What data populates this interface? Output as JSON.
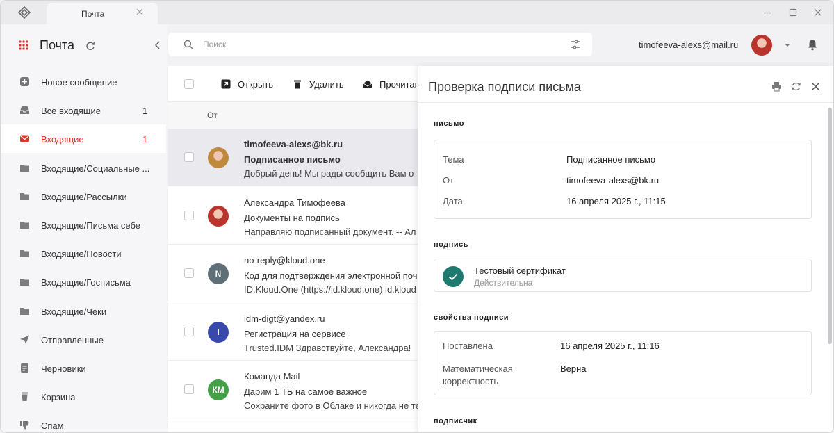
{
  "tab": {
    "title": "Почта"
  },
  "header": {
    "app_title": "Почта",
    "search_placeholder": "Поиск",
    "account_email": "timofeeva-alexs@mail.ru"
  },
  "sidebar": {
    "items": [
      {
        "label": "Новое сообщение",
        "icon": "plus-icon",
        "count": ""
      },
      {
        "label": "Все входящие",
        "icon": "inbox-icon",
        "count": "1"
      },
      {
        "label": "Входящие",
        "icon": "envelope-icon",
        "count": "1",
        "active": true
      },
      {
        "label": "Входящие/Социальные ...",
        "icon": "folder-icon",
        "count": ""
      },
      {
        "label": "Входящие/Рассылки",
        "icon": "folder-icon",
        "count": ""
      },
      {
        "label": "Входящие/Письма себе",
        "icon": "folder-icon",
        "count": ""
      },
      {
        "label": "Входящие/Новости",
        "icon": "folder-icon",
        "count": ""
      },
      {
        "label": "Входящие/Госписьма",
        "icon": "folder-icon",
        "count": ""
      },
      {
        "label": "Входящие/Чеки",
        "icon": "folder-icon",
        "count": ""
      },
      {
        "label": "Отправленные",
        "icon": "send-icon",
        "count": ""
      },
      {
        "label": "Черновики",
        "icon": "draft-icon",
        "count": ""
      },
      {
        "label": "Корзина",
        "icon": "trash-icon",
        "count": ""
      },
      {
        "label": "Спам",
        "icon": "thumbs-down-icon",
        "count": ""
      }
    ]
  },
  "toolbar": {
    "open_label": "Открыть",
    "delete_label": "Удалить",
    "read_label": "Прочитан"
  },
  "list": {
    "column_from": "От",
    "rows": [
      {
        "from": "timofeeva-alexs@bk.ru",
        "subject": "Подписанное письмо",
        "preview": "Добрый день! Мы рады сообщить Вам о",
        "avatar": "",
        "avatar_color": "#c08a3e"
      },
      {
        "from": "Александра Тимофеева",
        "subject": "Документы на подпись",
        "preview": "Направляю подписанный документ. -- Ал",
        "avatar": "",
        "avatar_color": "#b8342c"
      },
      {
        "from": "no-reply@kloud.one",
        "subject": "Код для подтверждения электронной поч",
        "preview": "ID.Kloud.One (https://id.kloud.one) id.kloud",
        "avatar": "N",
        "avatar_color": "#5f6f78"
      },
      {
        "from": "idm-digt@yandex.ru",
        "subject": "Регистрация на сервисе",
        "preview": "Trusted.IDM Здравствуйте, Александра! ",
        "avatar": "I",
        "avatar_color": "#3949ab"
      },
      {
        "from": "Команда Mail",
        "subject": "Дарим 1 ТБ на самое важное",
        "preview": "Сохраните фото в Облаке и никогда не те",
        "avatar": "КМ",
        "avatar_color": "#43a047"
      }
    ]
  },
  "panel": {
    "title": "Проверка подписи письма",
    "section_letter": "письмо",
    "letter": {
      "subject_key": "Тема",
      "subject_val": "Подписанное письмо",
      "from_key": "От",
      "from_val": "timofeeva-alexs@bk.ru",
      "date_key": "Дата",
      "date_val": "16 апреля 2025 г., 11:15"
    },
    "section_signature": "подпись",
    "certificate": {
      "name": "Тестовый сертификат",
      "status": "Действительна"
    },
    "section_props": "свойства подписи",
    "props": {
      "placed_key": "Поставлена",
      "placed_val": "16 апреля 2025 г., 11:16",
      "math_key_1": "Математическая",
      "math_key_2": "корректность",
      "math_val": "Верна"
    },
    "section_signer": "подписчик"
  },
  "colors": {
    "accent": "#e0342b",
    "check_green": "#1e7a6e"
  }
}
